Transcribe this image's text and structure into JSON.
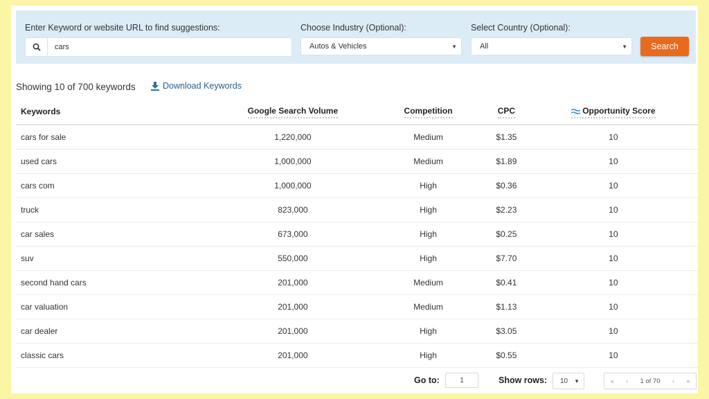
{
  "search_panel": {
    "keyword_label": "Enter Keyword or website URL to find suggestions:",
    "keyword_value": "cars",
    "industry_label": "Choose Industry (Optional):",
    "industry_selected": "Autos & Vehicles",
    "country_label": "Select Country (Optional):",
    "country_selected": "All",
    "search_button": "Search",
    "accent_color": "#ea6a1d"
  },
  "results": {
    "summary": "Showing 10 of 700 keywords",
    "download_label": "Download Keywords"
  },
  "table": {
    "headers": {
      "keywords": "Keywords",
      "volume": "Google Search Volume",
      "competition": "Competition",
      "cpc": "CPC",
      "opportunity": "Opportunity Score"
    },
    "rows": [
      {
        "keyword": "cars for sale",
        "volume": "1,220,000",
        "competition": "Medium",
        "cpc": "$1.35",
        "score": "10"
      },
      {
        "keyword": "used cars",
        "volume": "1,000,000",
        "competition": "Medium",
        "cpc": "$1.89",
        "score": "10"
      },
      {
        "keyword": "cars com",
        "volume": "1,000,000",
        "competition": "High",
        "cpc": "$0.36",
        "score": "10"
      },
      {
        "keyword": "truck",
        "volume": "823,000",
        "competition": "High",
        "cpc": "$2.23",
        "score": "10"
      },
      {
        "keyword": "car sales",
        "volume": "673,000",
        "competition": "High",
        "cpc": "$0.25",
        "score": "10"
      },
      {
        "keyword": "suv",
        "volume": "550,000",
        "competition": "High",
        "cpc": "$7.70",
        "score": "10"
      },
      {
        "keyword": "second hand cars",
        "volume": "201,000",
        "competition": "Medium",
        "cpc": "$0.41",
        "score": "10"
      },
      {
        "keyword": "car valuation",
        "volume": "201,000",
        "competition": "Medium",
        "cpc": "$1.13",
        "score": "10"
      },
      {
        "keyword": "car dealer",
        "volume": "201,000",
        "competition": "High",
        "cpc": "$3.05",
        "score": "10"
      },
      {
        "keyword": "classic cars",
        "volume": "201,000",
        "competition": "High",
        "cpc": "$0.55",
        "score": "10"
      }
    ]
  },
  "pagination": {
    "goto_label": "Go to:",
    "goto_value": "1",
    "rows_label": "Show rows:",
    "rows_value": "10",
    "first": "«",
    "prev": "‹",
    "page_text": "1 of 70",
    "next": "›",
    "last": "»"
  },
  "icons": {
    "search": "search-icon",
    "download": "download-icon",
    "opportunity": "waves-icon"
  }
}
